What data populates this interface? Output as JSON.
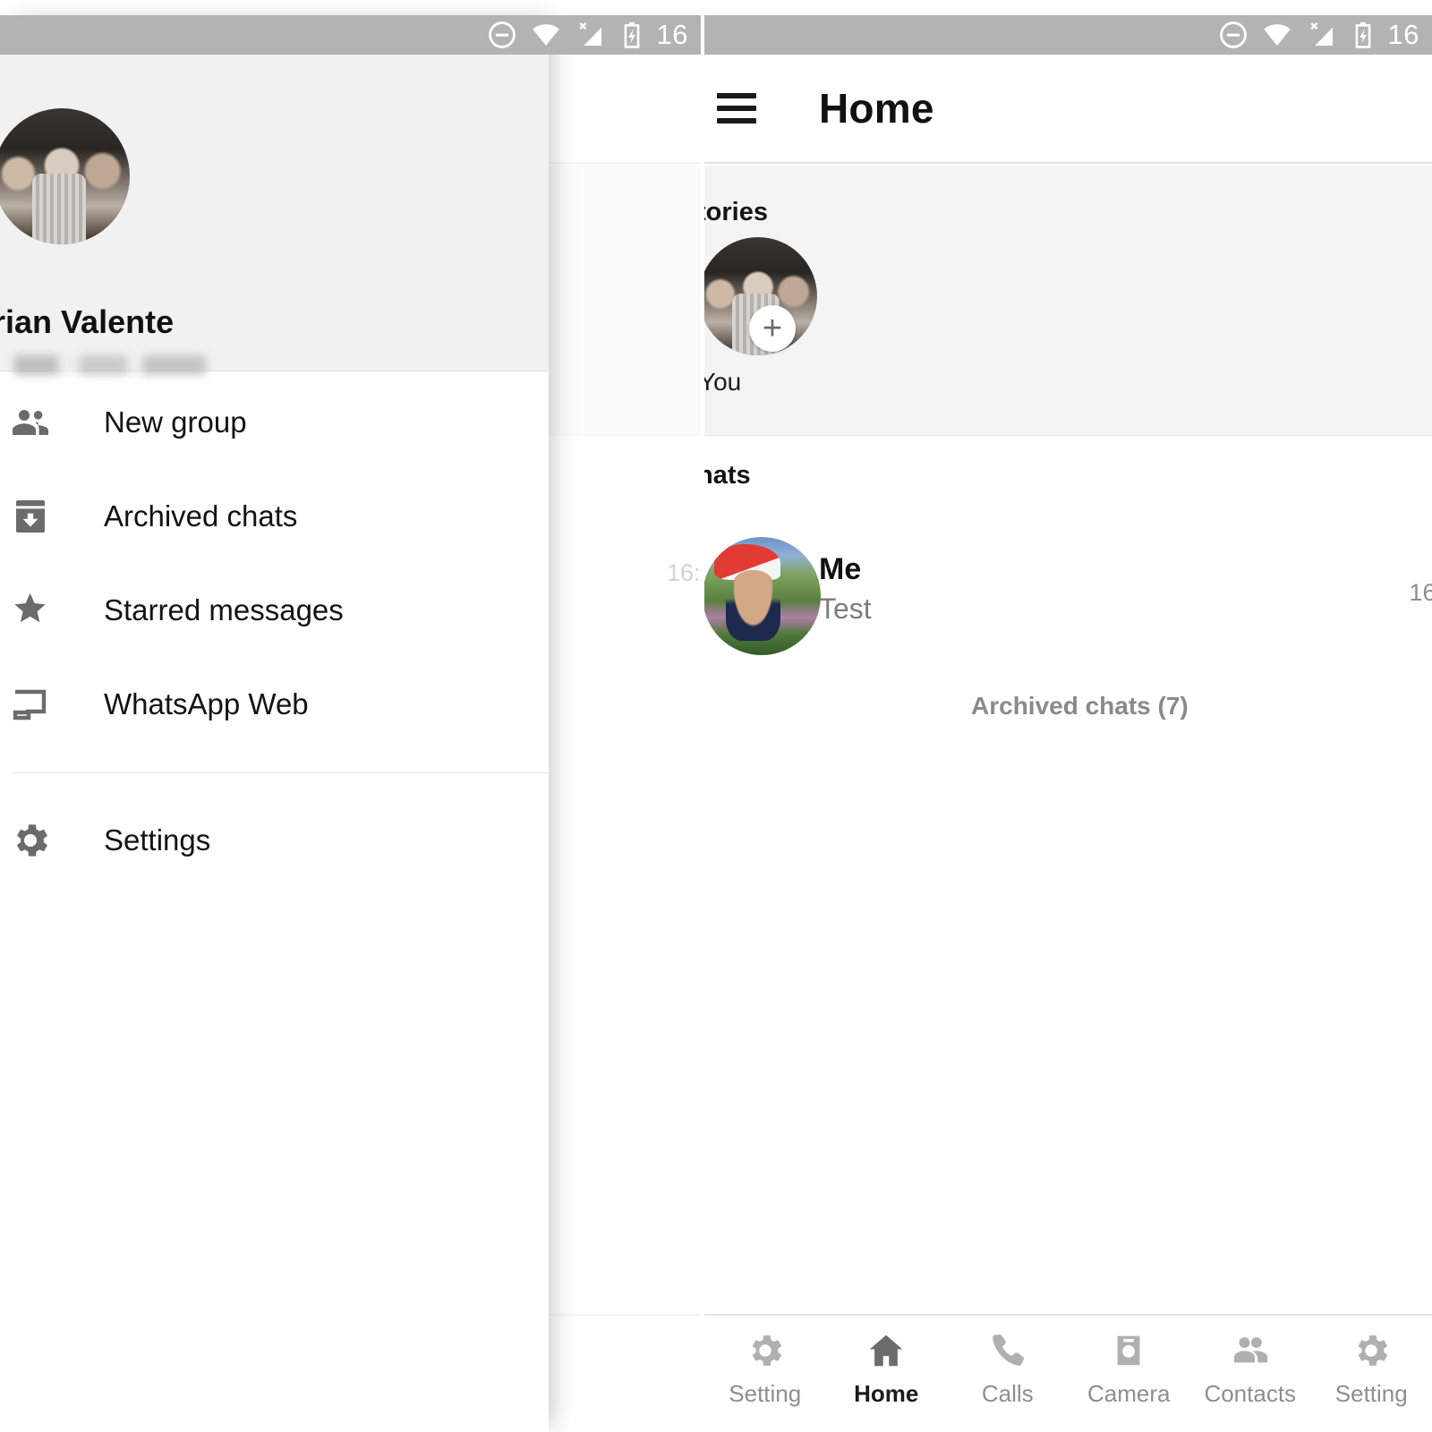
{
  "statusbar": {
    "time": "16",
    "icons": [
      "dnd-icon",
      "wifi-icon",
      "no-sim-signal-icon",
      "battery-charging-icon"
    ]
  },
  "drawer": {
    "profile": {
      "name": "rian Valente",
      "phone_redacted": true,
      "avatar": "group-photo-avatar"
    },
    "items": [
      {
        "label": "New group",
        "icon": "people-group-icon"
      },
      {
        "label": "Archived chats",
        "icon": "archive-box-icon"
      },
      {
        "label": "Starred messages",
        "icon": "star-icon"
      },
      {
        "label": "WhatsApp Web",
        "icon": "laptop-web-icon"
      },
      {
        "label": "Settings",
        "icon": "gear-icon"
      }
    ]
  },
  "home": {
    "appbar": {
      "menu_icon": "hamburger-icon",
      "title": "Home"
    },
    "stories": {
      "heading": "tories",
      "items": [
        {
          "label": "You",
          "avatar": "group-photo-avatar",
          "add_glyph": "+"
        }
      ]
    },
    "chats": {
      "heading": "hats",
      "rows": [
        {
          "name": "Me",
          "snippet": "Test",
          "time": "16:",
          "avatar": "santa-hat-avatar"
        }
      ],
      "archived_label": "Archived chats (7)"
    },
    "bottom_nav": {
      "items": [
        {
          "label": "Setting",
          "icon": "gear-icon",
          "active": false
        },
        {
          "label": "Home",
          "icon": "home-icon",
          "active": true
        },
        {
          "label": "Calls",
          "icon": "phone-icon",
          "active": false
        },
        {
          "label": "Camera",
          "icon": "camera-icon",
          "active": false
        },
        {
          "label": "Contacts",
          "icon": "contacts-icon",
          "active": false
        },
        {
          "label": "Setting",
          "icon": "gear-icon",
          "active": false
        }
      ]
    }
  },
  "left_screen_underlay": {
    "chat_time": "16:"
  },
  "colors": {
    "statusbar": "#b3b3b3",
    "stories_bg": "#f4f4f4",
    "drawer_header_bg": "#f1f1f1",
    "icon_grey": "#6b6b6b",
    "nav_inactive": "#b0b0b0",
    "nav_active": "#6b6b6b"
  }
}
